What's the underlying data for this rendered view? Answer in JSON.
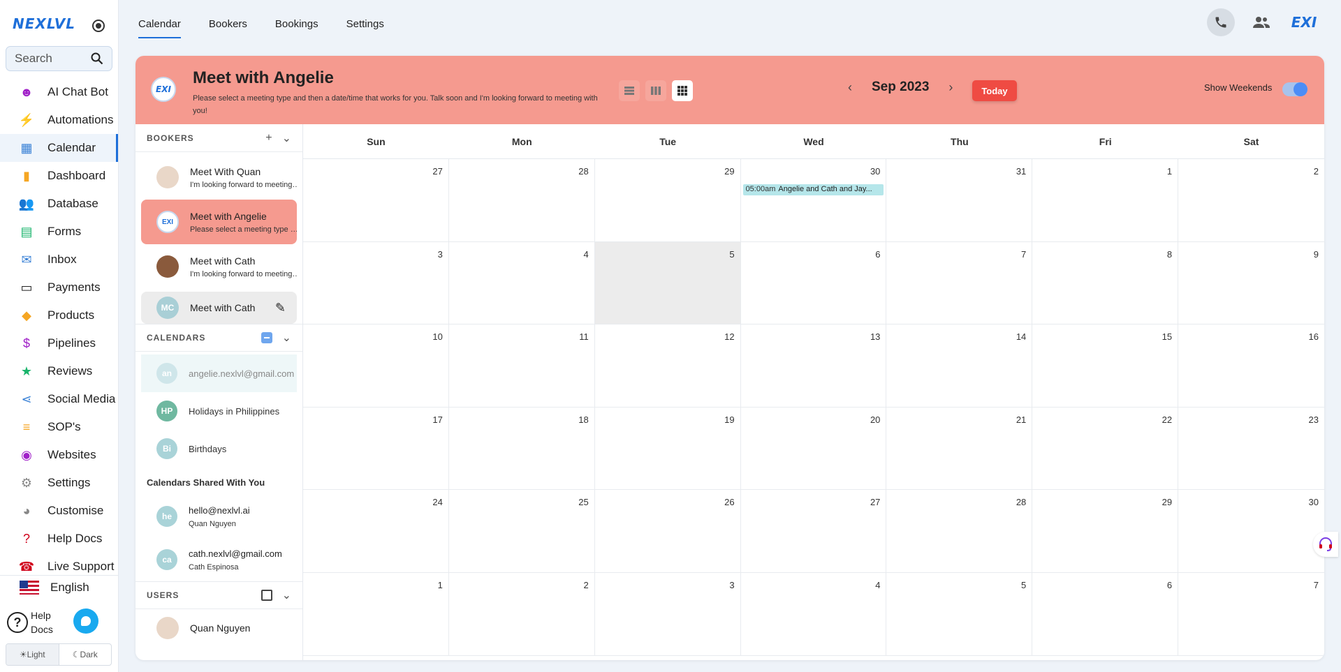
{
  "brand": {
    "name": "NEXLVL"
  },
  "sidebar": {
    "search_placeholder": "Search",
    "items": [
      {
        "label": "AI Chat Bot",
        "icon": "robot-icon",
        "color": "#a020c8"
      },
      {
        "label": "Automations",
        "icon": "automation-icon",
        "color": "#19b46b"
      },
      {
        "label": "Calendar",
        "icon": "calendar-icon",
        "color": "#3b82d6"
      },
      {
        "label": "Dashboard",
        "icon": "chart-icon",
        "color": "#f5a623"
      },
      {
        "label": "Database",
        "icon": "people-icon",
        "color": "#a020c8"
      },
      {
        "label": "Forms",
        "icon": "clipboard-icon",
        "color": "#19b46b"
      },
      {
        "label": "Inbox",
        "icon": "mail-icon",
        "color": "#3b82d6"
      },
      {
        "label": "Payments",
        "icon": "card-icon",
        "color": "#222222"
      },
      {
        "label": "Products",
        "icon": "tag-icon",
        "color": "#f5a623"
      },
      {
        "label": "Pipelines",
        "icon": "dollar-icon",
        "color": "#a020c8"
      },
      {
        "label": "Reviews",
        "icon": "star-icon",
        "color": "#19b46b"
      },
      {
        "label": "Social Media",
        "icon": "share-icon",
        "color": "#3b82d6"
      },
      {
        "label": "SOP's",
        "icon": "checklist-icon",
        "color": "#f5a623"
      },
      {
        "label": "Websites",
        "icon": "globe-icon",
        "color": "#a020c8"
      },
      {
        "label": "Settings",
        "icon": "gear-icon",
        "color": "#888888"
      },
      {
        "label": "Customise",
        "icon": "palette-icon",
        "color": "#888888"
      },
      {
        "label": "Help Docs",
        "icon": "question-icon",
        "color": "#d0021b"
      },
      {
        "label": "Live Support",
        "icon": "support-icon",
        "color": "#d0021b"
      }
    ],
    "active_index": 2,
    "language": "English",
    "help_label_1": "Help",
    "help_label_2": "Docs",
    "theme_light": "Light",
    "theme_dark": "Dark"
  },
  "topnav": {
    "tabs": [
      "Calendar",
      "Bookers",
      "Bookings",
      "Settings"
    ],
    "active_tab": 0,
    "logo_short": "EXI"
  },
  "header": {
    "avatar_text": "EXI",
    "title": "Meet with Angelie",
    "description": "Please select a meeting type and then a date/time that works for you. Talk soon and I'm looking forward to meeting with you!",
    "month": "Sep 2023",
    "today_label": "Today",
    "show_weekends_label": "Show Weekends",
    "show_weekends": true,
    "view": "month",
    "accent": "#f59a8f"
  },
  "bookers": {
    "title": "BOOKERS",
    "items": [
      {
        "name": "Meet With Quan",
        "desc": "I'm looking forward to meeting with you!",
        "avatar": "",
        "avatar_color": "#e9d7c8"
      },
      {
        "name": "Meet with Angelie",
        "desc": "Please select a meeting type and then a date/time",
        "avatar": "EXI",
        "avatar_color": "#ffffff"
      },
      {
        "name": "Meet with Cath",
        "desc": "I'm looking forward to meeting with you!",
        "avatar": "",
        "avatar_color": "#8a5a3c"
      },
      {
        "name": "Meet with Cath",
        "desc": "",
        "avatar": "MC",
        "avatar_color": "#a9cfd6"
      }
    ]
  },
  "calendars": {
    "title": "CALENDARS",
    "items": [
      {
        "name": "angelie.nexlvl@gmail.com",
        "avatar": "an",
        "color": "#cfe6ea"
      },
      {
        "name": "Holidays in Philippines",
        "avatar": "HP",
        "color": "#6fb8a0"
      },
      {
        "name": "Birthdays",
        "avatar": "Bi",
        "color": "#a9d3d8"
      }
    ],
    "shared_title": "Calendars Shared With You",
    "shared": [
      {
        "email": "hello@nexlvl.ai",
        "owner": "Quan Nguyen",
        "avatar": "he",
        "color": "#a9d3d8"
      },
      {
        "email": "cath.nexlvl@gmail.com",
        "owner": "Cath Espinosa",
        "avatar": "ca",
        "color": "#a9d3d8"
      }
    ]
  },
  "users": {
    "title": "USERS",
    "items": [
      {
        "name": "Quan Nguyen"
      }
    ]
  },
  "calendar_grid": {
    "weekdays": [
      "Sun",
      "Mon",
      "Tue",
      "Wed",
      "Thu",
      "Fri",
      "Sat"
    ],
    "days": [
      "27",
      "28",
      "29",
      "30",
      "31",
      "1",
      "2",
      "3",
      "4",
      "5",
      "6",
      "7",
      "8",
      "9",
      "10",
      "11",
      "12",
      "13",
      "14",
      "15",
      "16",
      "17",
      "18",
      "19",
      "20",
      "21",
      "22",
      "23",
      "24",
      "25",
      "26",
      "27",
      "28",
      "29",
      "30",
      "1",
      "2",
      "3",
      "4",
      "5",
      "6",
      "7"
    ],
    "today_index": 9,
    "events": [
      {
        "day_index": 3,
        "time": "05:00am",
        "title": "Angelie and Cath and Jay..."
      }
    ]
  }
}
